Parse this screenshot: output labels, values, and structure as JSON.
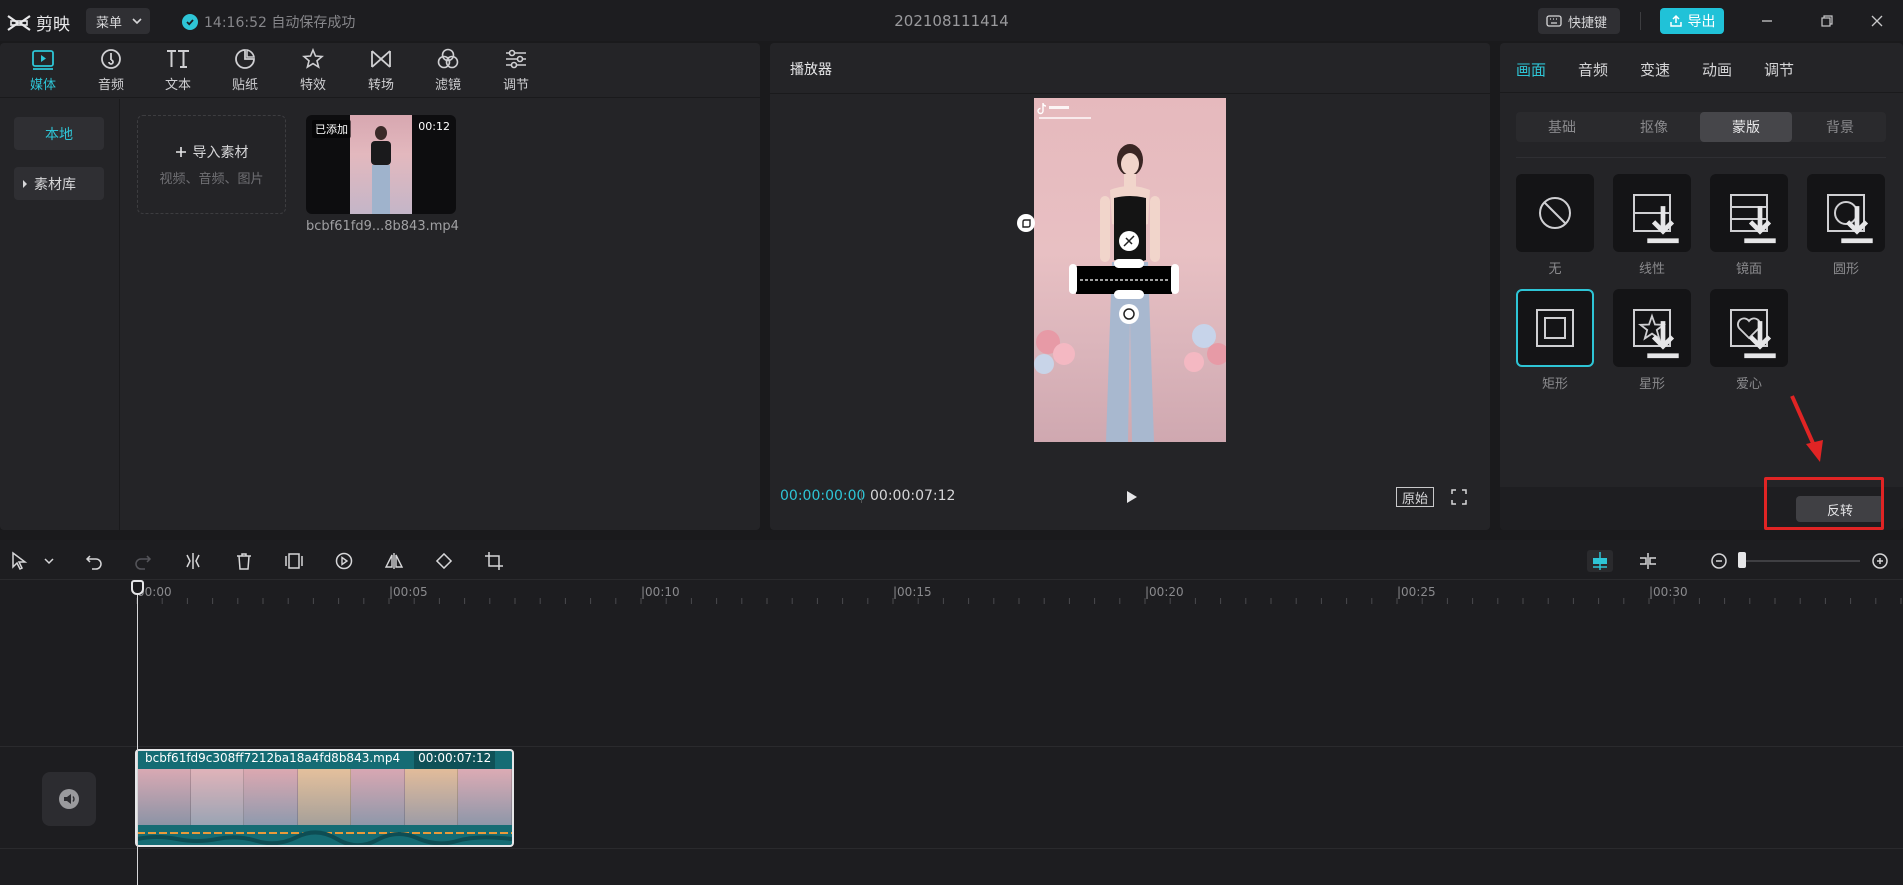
{
  "app": {
    "name": "剪映",
    "menu_label": "菜单",
    "save_status": "14:16:52 自动保存成功",
    "project_title": "202108111414",
    "shortcut_label": "快捷键",
    "export_label": "导出"
  },
  "media_tabs": [
    {
      "label": "媒体",
      "icon": "media-icon"
    },
    {
      "label": "音频",
      "icon": "audio-icon"
    },
    {
      "label": "文本",
      "icon": "text-icon"
    },
    {
      "label": "贴纸",
      "icon": "sticker-icon"
    },
    {
      "label": "特效",
      "icon": "effects-icon"
    },
    {
      "label": "转场",
      "icon": "transition-icon"
    },
    {
      "label": "滤镜",
      "icon": "filter-icon"
    },
    {
      "label": "调节",
      "icon": "adjust-icon"
    }
  ],
  "side_nav": {
    "local": "本地",
    "library": "素材库"
  },
  "import": {
    "label": "导入素材",
    "sub": "视频、音频、图片"
  },
  "media_item": {
    "tag": "已添加",
    "duration": "00:12",
    "name": "bcbf61fd9...8b843.mp4"
  },
  "player": {
    "title": "播放器",
    "current_time": "00:00:00:00",
    "total_time": "00:00:07:12",
    "original_label": "原始"
  },
  "inspector": {
    "tabs": [
      "画面",
      "音频",
      "变速",
      "动画",
      "调节"
    ],
    "subtabs": [
      "基础",
      "抠像",
      "蒙版",
      "背景"
    ],
    "masks": [
      {
        "label": "无",
        "icon": "none-mask-icon"
      },
      {
        "label": "线性",
        "icon": "linear-mask-icon"
      },
      {
        "label": "镜面",
        "icon": "mirror-mask-icon"
      },
      {
        "label": "圆形",
        "icon": "circle-mask-icon"
      },
      {
        "label": "矩形",
        "icon": "rectangle-mask-icon"
      },
      {
        "label": "星形",
        "icon": "star-mask-icon"
      },
      {
        "label": "爱心",
        "icon": "heart-mask-icon"
      }
    ],
    "invert_label": "反转"
  },
  "timeline": {
    "ruler_labels": [
      "00:00",
      "|00:05",
      "|00:10",
      "|00:15",
      "|00:20",
      "|00:25",
      "|00:30"
    ],
    "clip_name": "bcbf61fd9c308ff7212ba18a4fd8b843.mp4",
    "clip_duration": "00:00:07:12"
  },
  "colors": {
    "accent": "#2ec5d6",
    "highlight": "#e02424",
    "clip": "#156c74"
  }
}
